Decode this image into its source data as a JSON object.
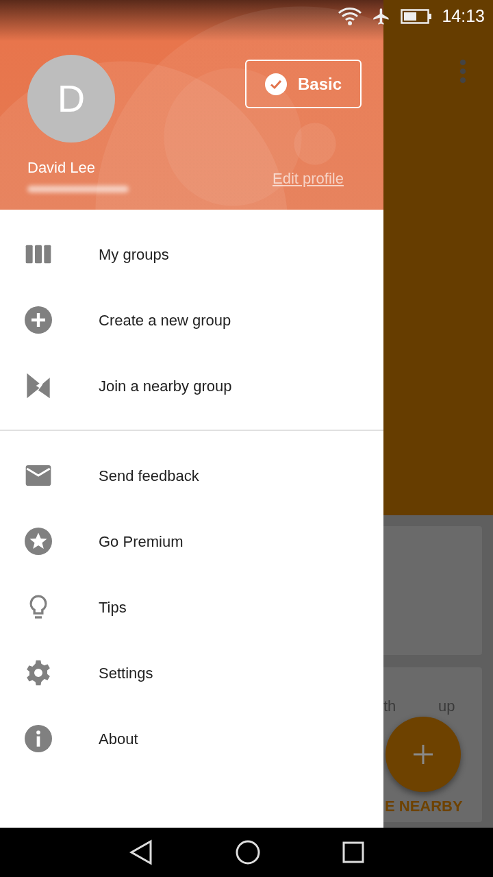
{
  "status_bar": {
    "time": "14:13"
  },
  "drawer": {
    "header": {
      "avatar_letter": "D",
      "name": "David Lee",
      "plan": {
        "label": "Basic",
        "checked": true
      },
      "edit_link": "Edit profile"
    },
    "sections": [
      {
        "items": [
          {
            "label": "My groups"
          },
          {
            "label": "Create a new group"
          },
          {
            "label": "Join a nearby group"
          }
        ]
      },
      {
        "items": [
          {
            "label": "Send feedback"
          },
          {
            "label": "Go Premium"
          },
          {
            "label": "Tips"
          },
          {
            "label": "Settings"
          },
          {
            "label": "About"
          }
        ]
      }
    ]
  },
  "background": {
    "card_texts": [
      "th",
      "up"
    ],
    "card_action": "E NEARBY"
  }
}
